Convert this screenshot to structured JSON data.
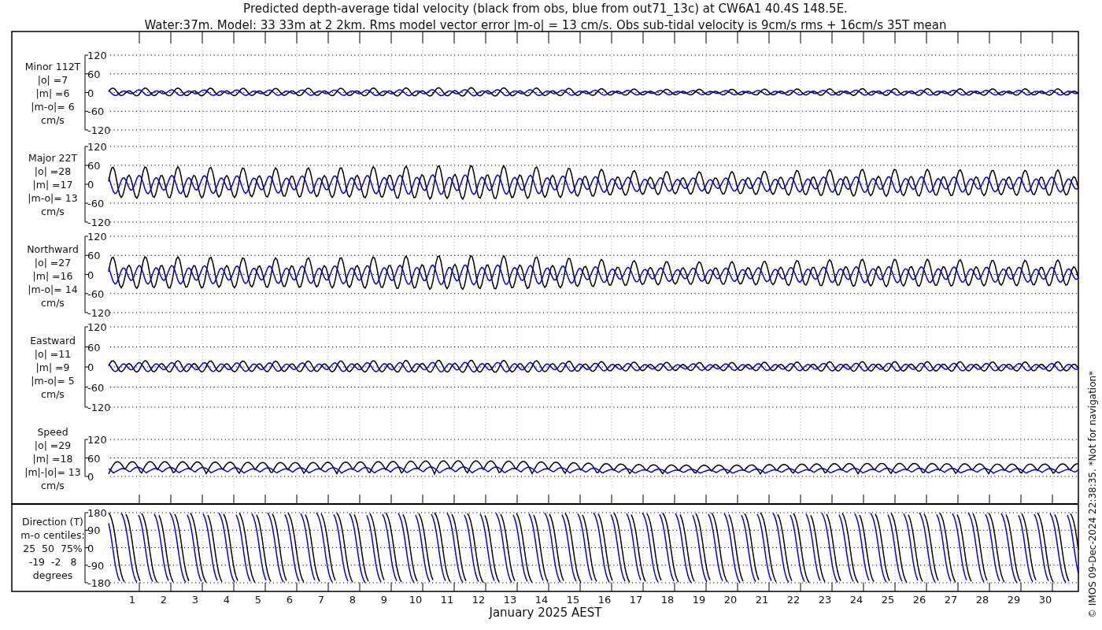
{
  "title": {
    "lines": [
      "Predicted depth-average tidal velocity (black from obs, blue from out71_13c) at CW6A1 40.4S 148.5E.",
      "Water:37m. Model: 33 33m at 2 2km. Rms model vector error |m-o| = 13 cm/s. Obs sub-tidal velocity is 9cm/s rms + 16cm/s 35T mean"
    ]
  },
  "panels": [
    {
      "kind": "signed",
      "label_lines": [
        "Minor 112T",
        "|o| =7",
        "|m| =6",
        "|m-o|= 6",
        "cm/s"
      ],
      "yticks": [
        "120",
        "60",
        "0",
        "-60",
        "-120"
      ]
    },
    {
      "kind": "signed",
      "label_lines": [
        "Major 22T",
        "|o| =28",
        "|m| =17",
        "|m-o|= 13",
        "cm/s"
      ],
      "yticks": [
        "120",
        "60",
        "0",
        "-60",
        "-120"
      ]
    },
    {
      "kind": "signed",
      "label_lines": [
        "Northward",
        "|o| =27",
        "|m| =16",
        "|m-o|= 14",
        "cm/s"
      ],
      "yticks": [
        "120",
        "60",
        "0",
        "-60",
        "-120"
      ]
    },
    {
      "kind": "signed",
      "label_lines": [
        "Eastward",
        "|o| =11",
        "|m| =9",
        "|m-o|= 5",
        "cm/s"
      ],
      "yticks": [
        "120",
        "60",
        "0",
        "-60",
        "-120"
      ]
    },
    {
      "kind": "speed",
      "label_lines": [
        "Speed",
        "|o| =29",
        "|m| =18",
        "|m|-|o|= 13",
        "cm/s"
      ],
      "yticks": [
        "120",
        "60",
        "0"
      ]
    },
    {
      "kind": "direction",
      "label_lines": [
        "Direction (T)",
        "m-o centiles:",
        "25  50  75%",
        "-19  -2   8",
        "degrees"
      ],
      "yticks": [
        "180",
        "90",
        "0",
        "-90",
        "-180"
      ]
    }
  ],
  "x_axis": {
    "ticks": [
      "1",
      "2",
      "3",
      "4",
      "5",
      "6",
      "7",
      "8",
      "9",
      "10",
      "11",
      "12",
      "13",
      "14",
      "15",
      "16",
      "17",
      "18",
      "19",
      "20",
      "21",
      "22",
      "23",
      "24",
      "25",
      "26",
      "27",
      "28",
      "29",
      "30"
    ],
    "label": "January 2025 AEST"
  },
  "footnote": "© IMOS 09-Dec-2024 22:38:35. *Not for navigation*"
}
